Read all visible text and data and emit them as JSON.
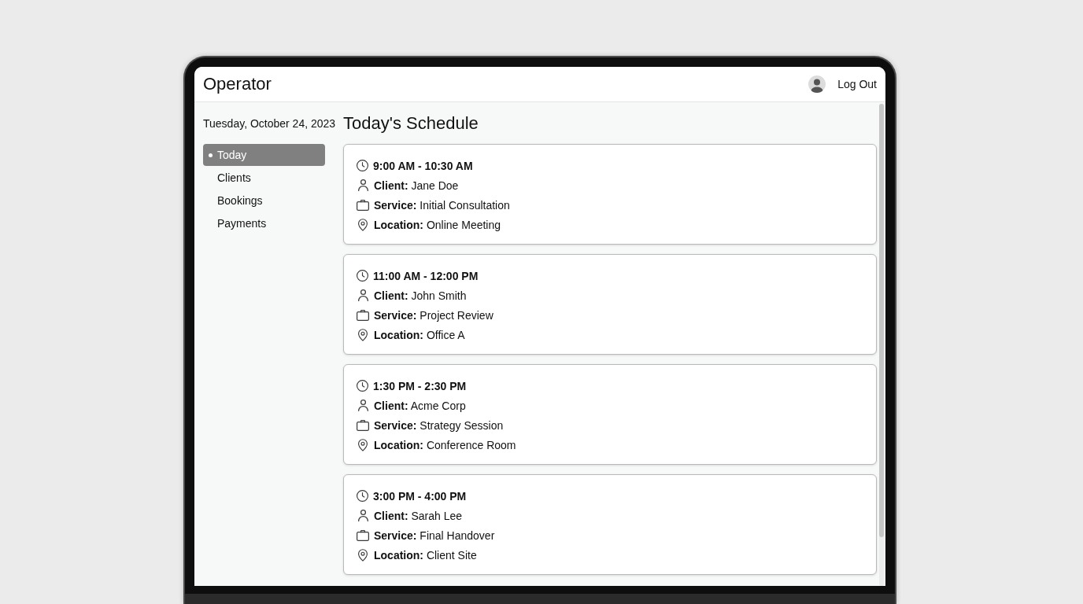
{
  "header": {
    "title": "Operator",
    "logout": "Log Out"
  },
  "sidebar": {
    "date": "Tuesday, October 24, 2023",
    "items": [
      {
        "label": "Today",
        "selected": true
      },
      {
        "label": "Clients",
        "selected": false
      },
      {
        "label": "Bookings",
        "selected": false
      },
      {
        "label": "Payments",
        "selected": false
      }
    ]
  },
  "schedule": {
    "heading": "Today's Schedule",
    "appointments": [
      {
        "time": "9:00 AM - 10:30 AM",
        "details": [
          {
            "kind": "client",
            "text": "**Client:** Jane Doe"
          },
          {
            "kind": "service",
            "text": "**Service:** Initial Consultation"
          },
          {
            "kind": "location",
            "text": "**Location:** Online Meeting"
          }
        ]
      },
      {
        "time": "11:00 AM - 12:00 PM",
        "details": [
          {
            "kind": "client",
            "text": "**Client:** John Smith"
          },
          {
            "kind": "service",
            "text": "**Service:** Project Review"
          },
          {
            "kind": "location",
            "text": "**Location:** Office A"
          }
        ]
      },
      {
        "time": "1:30 PM - 2:30 PM",
        "details": [
          {
            "kind": "client",
            "text": "**Client:** Acme Corp"
          },
          {
            "kind": "service",
            "text": "**Service:** Strategy Session"
          },
          {
            "kind": "location",
            "text": "**Location:** Conference Room"
          }
        ]
      },
      {
        "time": "3:00 PM - 4:00 PM",
        "details": [
          {
            "kind": "client",
            "text": "**Client:** Sarah Lee"
          },
          {
            "kind": "service",
            "text": "**Service:** Final Handover"
          },
          {
            "kind": "location",
            "text": "**Location:** Client Site"
          }
        ]
      }
    ]
  }
}
